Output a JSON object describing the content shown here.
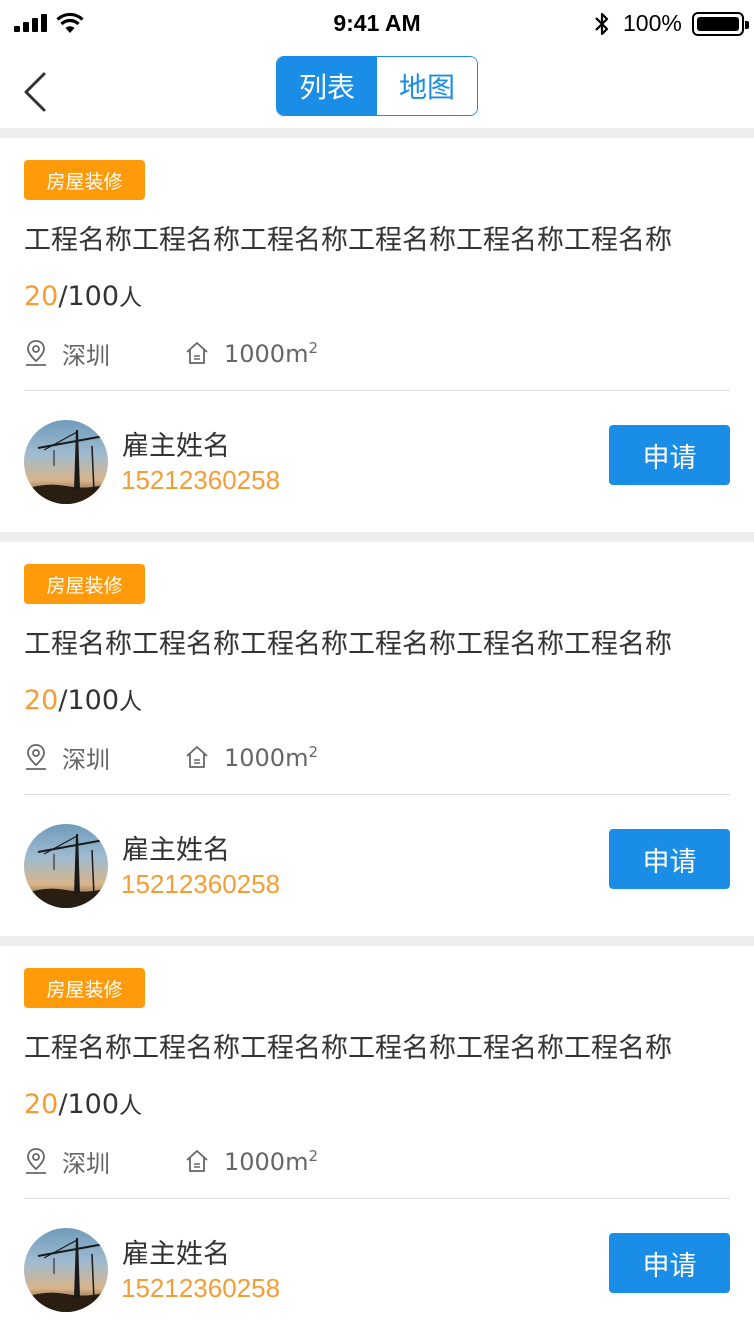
{
  "status_bar": {
    "time": "9:41 AM",
    "battery_pct": "100%",
    "icons": [
      "signal-icon",
      "wifi-icon",
      "bluetooth-icon",
      "battery-icon"
    ]
  },
  "nav": {
    "back_icon": "chevron-left-icon",
    "tabs": [
      {
        "label": "列表",
        "active": true
      },
      {
        "label": "地图",
        "active": false
      }
    ]
  },
  "colors": {
    "accent_blue": "#1a8ee6",
    "tag_orange": "#ff9a0b",
    "highlight_orange": "#f59d35",
    "separator": "#ededed"
  },
  "cards": [
    {
      "tag": "房屋装修",
      "title": "工程名称工程名称工程名称工程名称工程名称工程名称",
      "current": "20",
      "total": "/100",
      "unit": "人",
      "location": "深圳",
      "area": "1000m",
      "area_sup": "2",
      "employer": "雇主姓名",
      "phone": "15212360258",
      "apply_label": "申请"
    },
    {
      "tag": "房屋装修",
      "title": "工程名称工程名称工程名称工程名称工程名称工程名称",
      "current": "20",
      "total": "/100",
      "unit": "人",
      "location": "深圳",
      "area": "1000m",
      "area_sup": "2",
      "employer": "雇主姓名",
      "phone": "15212360258",
      "apply_label": "申请"
    },
    {
      "tag": "房屋装修",
      "title": "工程名称工程名称工程名称工程名称工程名称工程名称",
      "current": "20",
      "total": "/100",
      "unit": "人",
      "location": "深圳",
      "area": "1000m",
      "area_sup": "2",
      "employer": "雇主姓名",
      "phone": "15212360258",
      "apply_label": "申请"
    }
  ]
}
